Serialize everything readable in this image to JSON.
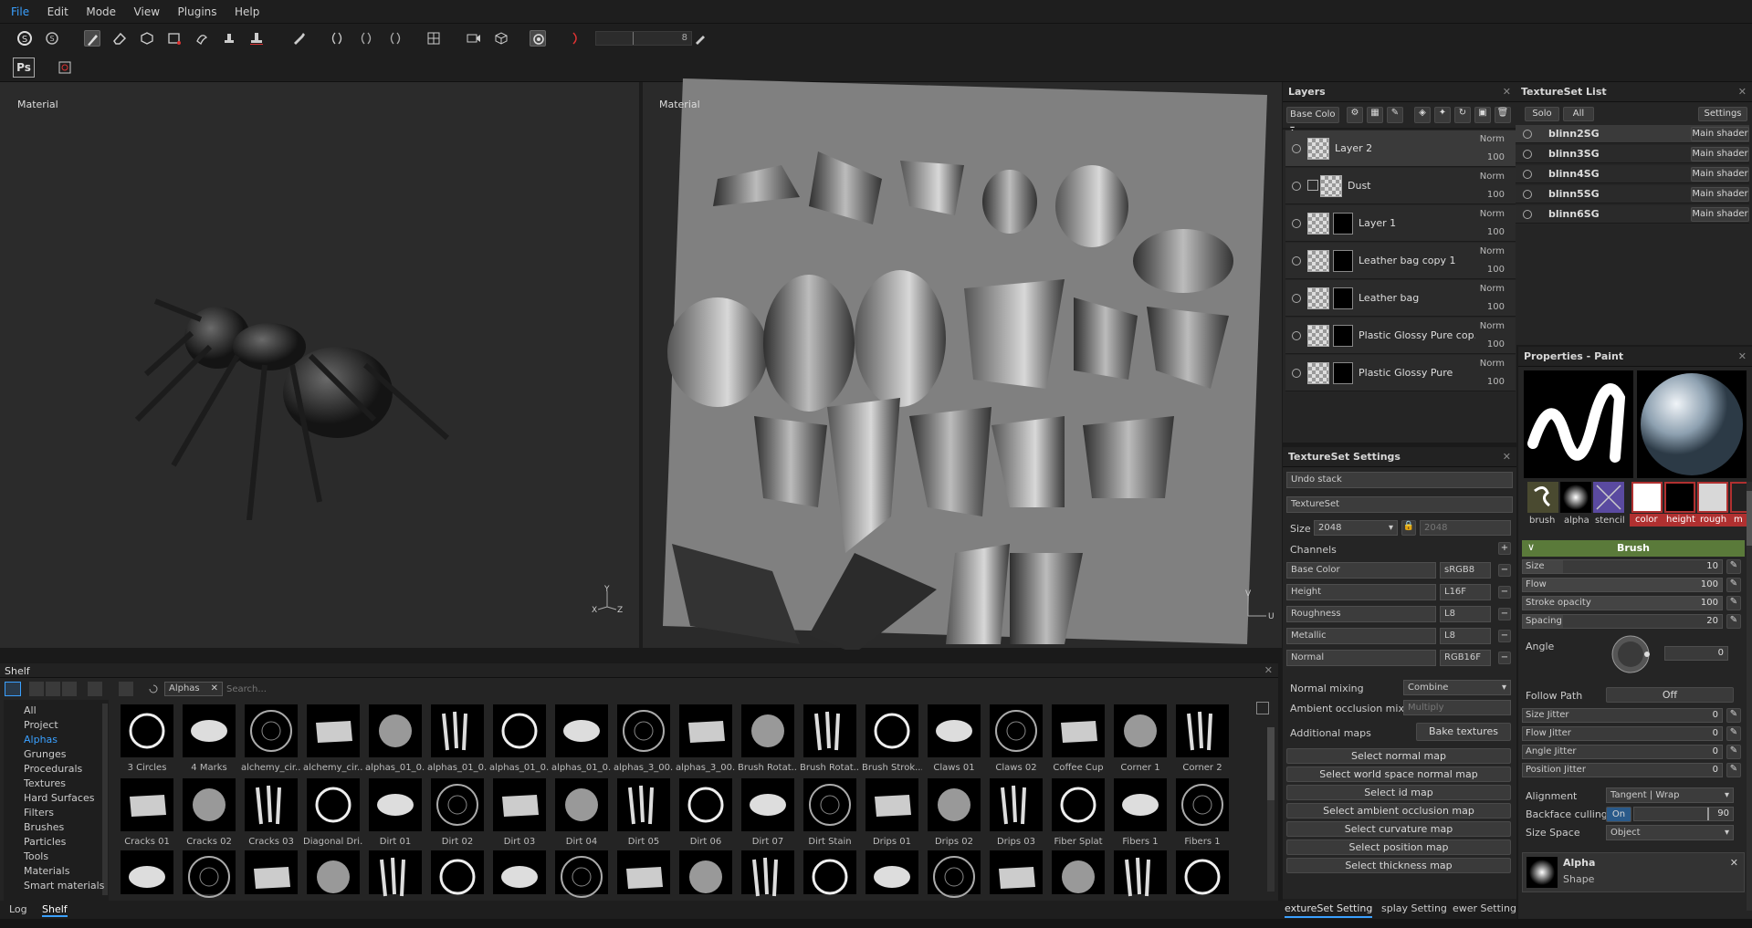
{
  "menu": {
    "file": "File",
    "edit": "Edit",
    "mode": "Mode",
    "view": "View",
    "plugins": "Plugins",
    "help": "Help"
  },
  "toolbar": {
    "brush_size": "8",
    "ps_label": "Ps"
  },
  "viewport": {
    "left_label": "Material",
    "right_label": "Material",
    "axis_x": "X",
    "axis_y": "Y",
    "axis_z": "Z",
    "uv_v": "V",
    "uv_u": "U"
  },
  "layers": {
    "title": "Layers",
    "channel": "Base Colo",
    "items": [
      {
        "name": "Layer 2",
        "blend": "Norm",
        "opacity": "100"
      },
      {
        "name": "Dust",
        "blend": "Norm",
        "opacity": "100"
      },
      {
        "name": "Layer 1",
        "blend": "Norm",
        "opacity": "100"
      },
      {
        "name": "Leather bag copy 1",
        "blend": "Norm",
        "opacity": "100"
      },
      {
        "name": "Leather bag",
        "blend": "Norm",
        "opacity": "100"
      },
      {
        "name": "Plastic Glossy Pure cop...",
        "blend": "Norm",
        "opacity": "100"
      },
      {
        "name": "Plastic Glossy Pure",
        "blend": "Norm",
        "opacity": "100"
      }
    ]
  },
  "textureset_list": {
    "title": "TextureSet List",
    "solo": "Solo",
    "all": "All",
    "settings": "Settings",
    "items": [
      {
        "name": "blinn2SG",
        "shader": "Main shader"
      },
      {
        "name": "blinn3SG",
        "shader": "Main shader"
      },
      {
        "name": "blinn4SG",
        "shader": "Main shader"
      },
      {
        "name": "blinn5SG",
        "shader": "Main shader"
      },
      {
        "name": "blinn6SG",
        "shader": "Main shader"
      }
    ]
  },
  "ts_settings": {
    "title": "TextureSet Settings",
    "undo": "Undo stack",
    "textureset": "TextureSet",
    "size_label": "Size",
    "size": "2048",
    "size2": "2048",
    "channels": "Channels",
    "channel_rows": [
      {
        "name": "Base Color",
        "fmt": "sRGB8"
      },
      {
        "name": "Height",
        "fmt": "L16F"
      },
      {
        "name": "Roughness",
        "fmt": "L8"
      },
      {
        "name": "Metallic",
        "fmt": "L8"
      },
      {
        "name": "Normal",
        "fmt": "RGB16F"
      }
    ],
    "normal_mixing_label": "Normal mixing",
    "normal_mixing": "Combine",
    "ao_mixing_label": "Ambient occlusion mixing",
    "ao_mixing": "Multiply",
    "additional_maps": "Additional maps",
    "bake": "Bake textures",
    "maps": [
      "Select normal map",
      "Select world space normal map",
      "Select id map",
      "Select ambient occlusion map",
      "Select curvature map",
      "Select position map",
      "Select thickness map"
    ]
  },
  "properties": {
    "title": "Properties - Paint",
    "brush_thumb": "brush",
    "alpha_thumb": "alpha",
    "stencil_thumb": "stencil",
    "chan_color": "color",
    "chan_height": "height",
    "chan_rough": "rough",
    "chan_m": "m",
    "brush_section": "Brush",
    "size_label": "Size",
    "size": "10",
    "flow_label": "Flow",
    "flow": "100",
    "stroke_label": "Stroke opacity",
    "stroke": "100",
    "spacing_label": "Spacing",
    "spacing": "20",
    "angle_label": "Angle",
    "angle": "0",
    "follow_path_label": "Follow Path",
    "follow_path": "Off",
    "size_jitter_label": "Size Jitter",
    "size_jitter": "0",
    "flow_jitter_label": "Flow Jitter",
    "flow_jitter": "0",
    "angle_jitter_label": "Angle Jitter",
    "angle_jitter": "0",
    "pos_jitter_label": "Position Jitter",
    "pos_jitter": "0",
    "alignment_label": "Alignment",
    "alignment": "Tangent | Wrap",
    "backface_label": "Backface culling",
    "backface_on": "On",
    "backface": "90",
    "sizespace_label": "Size Space",
    "sizespace": "Object",
    "alpha_title": "Alpha",
    "alpha_sub": "Shape"
  },
  "bottom_tabs": {
    "ts": "extureSet Setting",
    "disp": "splay Setting",
    "viewer": "ewer Setting"
  },
  "shelf": {
    "title": "Shelf",
    "filter": "Alphas",
    "search_placeholder": "Search...",
    "categories": [
      "All",
      "Project",
      "Alphas",
      "Grunges",
      "Procedurals",
      "Textures",
      "Hard Surfaces",
      "Filters",
      "Brushes",
      "Particles",
      "Tools",
      "Materials",
      "Smart materials"
    ],
    "row1": [
      "3 Circles",
      "4 Marks",
      "alchemy_cir...",
      "alchemy_cir...",
      "alphas_01_0...",
      "alphas_01_0...",
      "alphas_01_0...",
      "alphas_01_0...",
      "alphas_3_00...",
      "alphas_3_00...",
      "Brush Rotat...",
      "Brush Rotat...",
      "Brush Strok...",
      "Claws 01",
      "Claws 02",
      "Coffee Cup",
      "Corner 1",
      "Corner 2"
    ],
    "row2": [
      "Cracks 01",
      "Cracks 02",
      "Cracks 03",
      "Diagonal Dri...",
      "Dirt 01",
      "Dirt 02",
      "Dirt 03",
      "Dirt 04",
      "Dirt 05",
      "Dirt 06",
      "Dirt 07",
      "Dirt Stain",
      "Drips 01",
      "Drips 02",
      "Drips 03",
      "Fiber Splat",
      "Fibers 1",
      "Fibers 1"
    ]
  },
  "status": {
    "log": "Log",
    "shelf": "Shelf"
  }
}
